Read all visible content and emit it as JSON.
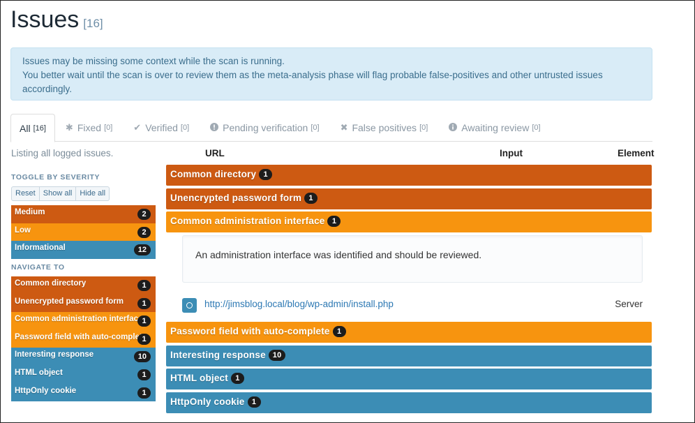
{
  "page": {
    "title": "Issues",
    "count": "[16]"
  },
  "alert": {
    "line1": "Issues may be missing some context while the scan is running.",
    "line2": "You better wait until the scan is over to review them as the meta-analysis phase will flag probable false-positives and other untrusted issues accordingly."
  },
  "tabs": [
    {
      "label": "All",
      "count": "[16]",
      "icon": ""
    },
    {
      "label": "Fixed",
      "count": "[0]",
      "icon": "asterisk-icon"
    },
    {
      "label": "Verified",
      "count": "[0]",
      "icon": "check-icon"
    },
    {
      "label": "Pending verification",
      "count": "[0]",
      "icon": "exclamation-circle-icon"
    },
    {
      "label": "False positives",
      "count": "[0]",
      "icon": "x-icon"
    },
    {
      "label": "Awaiting review",
      "count": "[0]",
      "icon": "info-circle-icon"
    }
  ],
  "sidebar": {
    "listing": "Listing all logged issues.",
    "toggle_heading": "TOGGLE BY SEVERITY",
    "buttons": {
      "reset": "Reset",
      "show_all": "Show all",
      "hide_all": "Hide all"
    },
    "severities": [
      {
        "label": "Medium",
        "count": "2"
      },
      {
        "label": "Low",
        "count": "2"
      },
      {
        "label": "Informational",
        "count": "12"
      }
    ],
    "navigate_heading": "NAVIGATE TO",
    "nav": [
      {
        "label": "Common directory",
        "count": "1"
      },
      {
        "label": "Unencrypted password form",
        "count": "1"
      },
      {
        "label": "Common administration interface",
        "count": "1"
      },
      {
        "label": "Password field with auto-complete",
        "count": "1"
      },
      {
        "label": "Interesting response",
        "count": "10"
      },
      {
        "label": "HTML object",
        "count": "1"
      },
      {
        "label": "HttpOnly cookie",
        "count": "1"
      }
    ]
  },
  "columns": {
    "url": "URL",
    "input": "Input",
    "element": "Element"
  },
  "issues": [
    {
      "title": "Common directory",
      "count": "1"
    },
    {
      "title": "Unencrypted password form",
      "count": "1"
    },
    {
      "title": "Common administration interface",
      "count": "1"
    },
    {
      "title": "Password field with auto-complete",
      "count": "1"
    },
    {
      "title": "Interesting response",
      "count": "10"
    },
    {
      "title": "HTML object",
      "count": "1"
    },
    {
      "title": "HttpOnly cookie",
      "count": "1"
    }
  ],
  "detail": {
    "description": "An administration interface was identified and should be reviewed.",
    "url": "http://jimsblog.local/blog/wp-admin/install.php",
    "element": "Server"
  },
  "colors": {
    "medium": "#cd5a12",
    "low": "#f7940f",
    "informational": "#3c8db5"
  }
}
